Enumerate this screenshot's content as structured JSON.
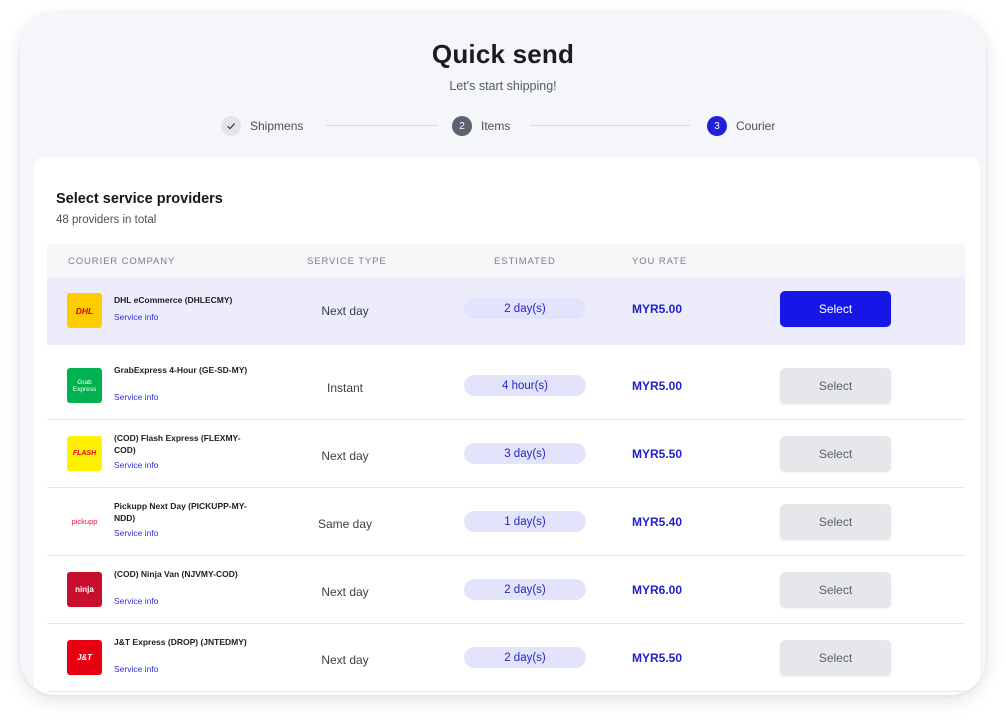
{
  "header": {
    "title": "Quick send",
    "subtitle": "Let's start shipping!"
  },
  "stepper": [
    {
      "label": "Shipmens",
      "marker": "✓",
      "state": "completed"
    },
    {
      "label": "Items",
      "marker": "2",
      "state": "completed"
    },
    {
      "label": "Courier",
      "marker": "3",
      "state": "active"
    }
  ],
  "section": {
    "title": "Select service providers",
    "subtitle": "48 providers in total"
  },
  "table": {
    "columns": [
      "COURIER COMPANY",
      "SERVICE TYPE",
      "ESTIMATED",
      "YOU RATE"
    ],
    "rows": [
      {
        "logo_text": "DHL",
        "logo_icon": "dhl-logo",
        "name": "DHL eCommerce (DHLECMY)",
        "info": "Service info",
        "service_type": "Next day",
        "estimated": "2 day(s)",
        "rate": "MYR5.00",
        "button": "Select",
        "selected": true
      },
      {
        "logo_text": "Grab Express",
        "logo_icon": "grab-logo",
        "name": "GrabExpress 4-Hour (GE-SD-MY)",
        "info": "Service info",
        "service_type": "Instant",
        "estimated": "4 hour(s)",
        "rate": "MYR5.00",
        "button": "Select",
        "selected": false
      },
      {
        "logo_text": "FLASH",
        "logo_icon": "flash-express-logo",
        "name": "(COD) Flash Express (FLEXMY-COD)",
        "info": "Service info",
        "service_type": "Next day",
        "estimated": "3 day(s)",
        "rate": "MYR5.50",
        "button": "Select",
        "selected": false
      },
      {
        "logo_text": "pickupp",
        "logo_icon": "pickupp-logo",
        "name": "Pickupp Next Day (PICKUPP-MY-NDD)",
        "info": "Service info",
        "service_type": "Same day",
        "estimated": "1 day(s)",
        "rate": "MYR5.40",
        "button": "Select",
        "selected": false
      },
      {
        "logo_text": "ninja",
        "logo_icon": "ninja-van-logo",
        "name": "(COD) Ninja Van (NJVMY-COD)",
        "info": "Service info",
        "service_type": "Next day",
        "estimated": "2 day(s)",
        "rate": "MYR6.00",
        "button": "Select",
        "selected": false
      },
      {
        "logo_text": "J&T",
        "logo_icon": "jt-express-logo",
        "name": "J&T Express (DROP) (JNTEDMY)",
        "info": "Service info",
        "service_type": "Next day",
        "estimated": "2 day(s)",
        "rate": "MYR5.50",
        "button": "Select",
        "selected": false
      }
    ]
  },
  "colors": {
    "accent": "#1616e6",
    "rate_text": "#1f1fc9",
    "selected_row": "#ececfb",
    "pill_bg": "#e3e4fb"
  }
}
